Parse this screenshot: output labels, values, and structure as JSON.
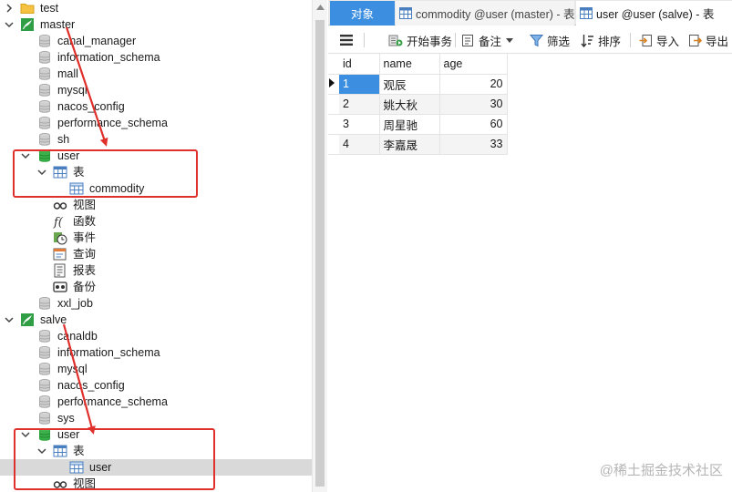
{
  "navigator": {
    "items": [
      {
        "label": "test",
        "kind": "folder",
        "level": 0,
        "chevron": "right"
      },
      {
        "label": "master",
        "kind": "connection",
        "level": 0,
        "chevron": "down"
      },
      {
        "label": "canal_manager",
        "kind": "database",
        "level": 1
      },
      {
        "label": "information_schema",
        "kind": "database",
        "level": 1
      },
      {
        "label": "mall",
        "kind": "database",
        "level": 1
      },
      {
        "label": "mysql",
        "kind": "database",
        "level": 1
      },
      {
        "label": "nacos_config",
        "kind": "database",
        "level": 1
      },
      {
        "label": "performance_schema",
        "kind": "database",
        "level": 1
      },
      {
        "label": "sh",
        "kind": "database",
        "level": 1
      },
      {
        "label": "user",
        "kind": "database-open",
        "level": 1,
        "chevron": "down"
      },
      {
        "label": "表",
        "kind": "tables",
        "level": 2,
        "chevron": "down"
      },
      {
        "label": "commodity",
        "kind": "table",
        "level": 3
      },
      {
        "label": "视图",
        "kind": "views",
        "level": 2
      },
      {
        "label": "函数",
        "kind": "functions",
        "level": 2
      },
      {
        "label": "事件",
        "kind": "events",
        "level": 2
      },
      {
        "label": "查询",
        "kind": "queries",
        "level": 2
      },
      {
        "label": "报表",
        "kind": "reports",
        "level": 2
      },
      {
        "label": "备份",
        "kind": "backups",
        "level": 2
      },
      {
        "label": "xxl_job",
        "kind": "database",
        "level": 1
      },
      {
        "label": "salve",
        "kind": "connection",
        "level": 0,
        "chevron": "down"
      },
      {
        "label": "canaldb",
        "kind": "database",
        "level": 1
      },
      {
        "label": "information_schema",
        "kind": "database",
        "level": 1
      },
      {
        "label": "mysql",
        "kind": "database",
        "level": 1
      },
      {
        "label": "nacos_config",
        "kind": "database",
        "level": 1
      },
      {
        "label": "performance_schema",
        "kind": "database",
        "level": 1
      },
      {
        "label": "sys",
        "kind": "database",
        "level": 1
      },
      {
        "label": "user",
        "kind": "database-open",
        "level": 1,
        "chevron": "down"
      },
      {
        "label": "表",
        "kind": "tables",
        "level": 2,
        "chevron": "down"
      },
      {
        "label": "user",
        "kind": "table",
        "level": 3,
        "selected": true
      },
      {
        "label": "视图",
        "kind": "views",
        "level": 2
      }
    ]
  },
  "tabs": [
    {
      "label": "对象",
      "active": false
    },
    {
      "label": "commodity @user (master) - 表",
      "active": false
    },
    {
      "label": "user @user (salve) - 表",
      "active": true
    }
  ],
  "toolbar": {
    "menu_icon": "hamburger-icon",
    "begin_transaction": "开始事务",
    "memo": "备注",
    "filter": "筛选",
    "sort": "排序",
    "import": "导入",
    "export": "导出"
  },
  "grid": {
    "columns": [
      "id",
      "name",
      "age"
    ],
    "rows": [
      [
        "1",
        "观辰",
        "20"
      ],
      [
        "2",
        "姚大秋",
        "30"
      ],
      [
        "3",
        "周星驰",
        "60"
      ],
      [
        "4",
        "李嘉晟",
        "33"
      ]
    ],
    "active_row": 0
  },
  "watermark": "@稀土掘金技术社区",
  "colors": {
    "accent": "#3c8fe0",
    "annotation_red": "#e0302c",
    "database_green": "#27a43a",
    "selection_gray": "#d9d9d9"
  }
}
